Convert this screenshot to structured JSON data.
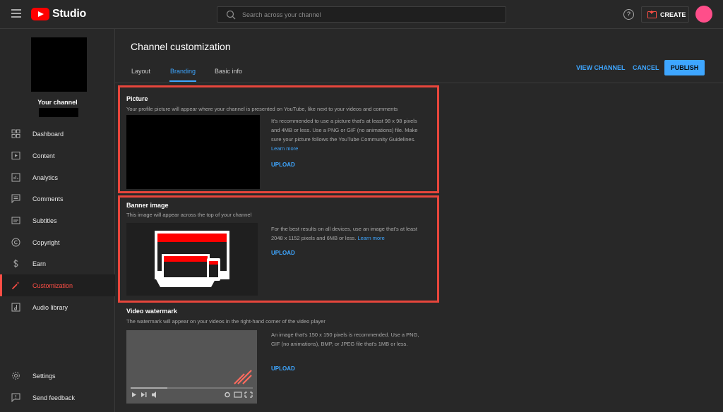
{
  "header": {
    "logo_text": "Studio",
    "search_placeholder": "Search across your channel",
    "create_label": "CREATE"
  },
  "sidebar": {
    "channel_title": "Your channel",
    "items": [
      {
        "label": "Dashboard",
        "icon": "dashboard-icon"
      },
      {
        "label": "Content",
        "icon": "content-icon"
      },
      {
        "label": "Analytics",
        "icon": "analytics-icon"
      },
      {
        "label": "Comments",
        "icon": "comments-icon"
      },
      {
        "label": "Subtitles",
        "icon": "subtitles-icon"
      },
      {
        "label": "Copyright",
        "icon": "copyright-icon"
      },
      {
        "label": "Earn",
        "icon": "earn-icon"
      },
      {
        "label": "Customization",
        "icon": "customization-icon",
        "active": true
      },
      {
        "label": "Audio library",
        "icon": "audio-library-icon"
      }
    ],
    "bottom_items": [
      {
        "label": "Settings",
        "icon": "gear-icon"
      },
      {
        "label": "Send feedback",
        "icon": "feedback-icon"
      }
    ]
  },
  "main": {
    "title": "Channel customization",
    "tabs": [
      {
        "label": "Layout"
      },
      {
        "label": "Branding",
        "active": true
      },
      {
        "label": "Basic info"
      }
    ],
    "actions": {
      "view_channel": "VIEW CHANNEL",
      "cancel": "CANCEL",
      "publish": "PUBLISH"
    },
    "picture": {
      "title": "Picture",
      "description": "Your profile picture will appear where your channel is presented on YouTube, like next to your videos and comments",
      "info": "It's recommended to use a picture that's at least 98 x 98 pixels and 4MB or less. Use a PNG or GIF (no animations) file. Make sure your picture follows the YouTube Community Guidelines.",
      "learn_more": "Learn more",
      "upload": "UPLOAD"
    },
    "banner": {
      "title": "Banner image",
      "description": "This image will appear across the top of your channel",
      "info": "For the best results on all devices, use an image that's at least 2048 x 1152 pixels and 6MB or less.",
      "learn_more": "Learn more",
      "upload": "UPLOAD"
    },
    "watermark": {
      "title": "Video watermark",
      "description": "The watermark will appear on your videos in the right-hand corner of the video player",
      "info": "An image that's 150 x 150 pixels is recommended. Use a PNG, GIF (no animations), BMP, or JPEG file that's 1MB or less.",
      "upload": "UPLOAD"
    }
  },
  "colors": {
    "accent": "#3ea6ff",
    "active": "#ff4e45",
    "highlight": "#e8463c",
    "background": "#282828"
  }
}
